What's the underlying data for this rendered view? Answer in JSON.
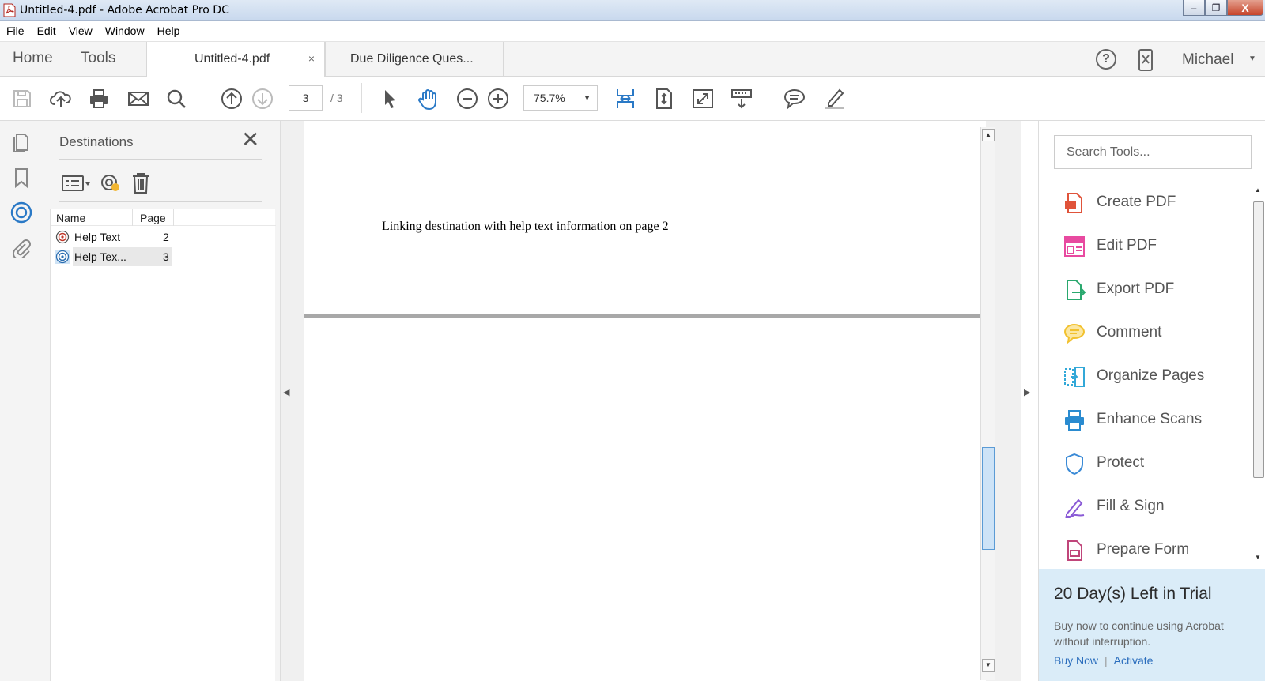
{
  "window": {
    "title": "Untitled-4.pdf - Adobe Acrobat Pro DC",
    "minimize": "‒",
    "maximize": "❐",
    "close": "X"
  },
  "menu": [
    "File",
    "Edit",
    "View",
    "Window",
    "Help"
  ],
  "nav": {
    "home": "Home",
    "tools": "Tools"
  },
  "tabs": [
    {
      "label": "Untitled-4.pdf",
      "close": "×",
      "active": true
    },
    {
      "label": "Due Diligence Ques...",
      "active": false
    }
  ],
  "header": {
    "help": "?",
    "user": "Michael",
    "user_caret": "▼"
  },
  "toolbar": {
    "current_page": "3",
    "total_pages": "/ 3",
    "zoom": "75.7%",
    "zoom_caret": "▼"
  },
  "destinations_panel": {
    "title": "Destinations",
    "close": "✕",
    "columns": {
      "name": "Name",
      "page": "Page"
    },
    "rows": [
      {
        "name": "Help Text",
        "page": "2",
        "selected": false
      },
      {
        "name": "Help Tex...",
        "page": "3",
        "selected": true
      }
    ]
  },
  "document": {
    "text": "Linking destination with help text information on page 2",
    "collapse_left": "◀",
    "collapse_right": "▶",
    "scroll_up": "▲",
    "scroll_down": "▼"
  },
  "tools_pane": {
    "search_placeholder": "Search Tools...",
    "tools": [
      {
        "label": "Create PDF",
        "icon": "create-pdf-icon",
        "color": "#e0533a"
      },
      {
        "label": "Edit PDF",
        "icon": "edit-pdf-icon",
        "color": "#e84aa0"
      },
      {
        "label": "Export PDF",
        "icon": "export-pdf-icon",
        "color": "#2aa86e"
      },
      {
        "label": "Comment",
        "icon": "comment-icon",
        "color": "#f2c12e"
      },
      {
        "label": "Organize Pages",
        "icon": "organize-pages-icon",
        "color": "#32a8d8"
      },
      {
        "label": "Enhance Scans",
        "icon": "enhance-scans-icon",
        "color": "#2a8bd0"
      },
      {
        "label": "Protect",
        "icon": "protect-icon",
        "color": "#3a8ad6"
      },
      {
        "label": "Fill & Sign",
        "icon": "fill-sign-icon",
        "color": "#8a5ad6"
      },
      {
        "label": "Prepare Form",
        "icon": "prepare-form-icon",
        "color": "#c0457a"
      }
    ]
  },
  "trial": {
    "heading": "20 Day(s) Left in Trial",
    "message": "Buy now to continue using Acrobat without interruption.",
    "buy_now": "Buy Now",
    "divider": "|",
    "activate": "Activate"
  }
}
